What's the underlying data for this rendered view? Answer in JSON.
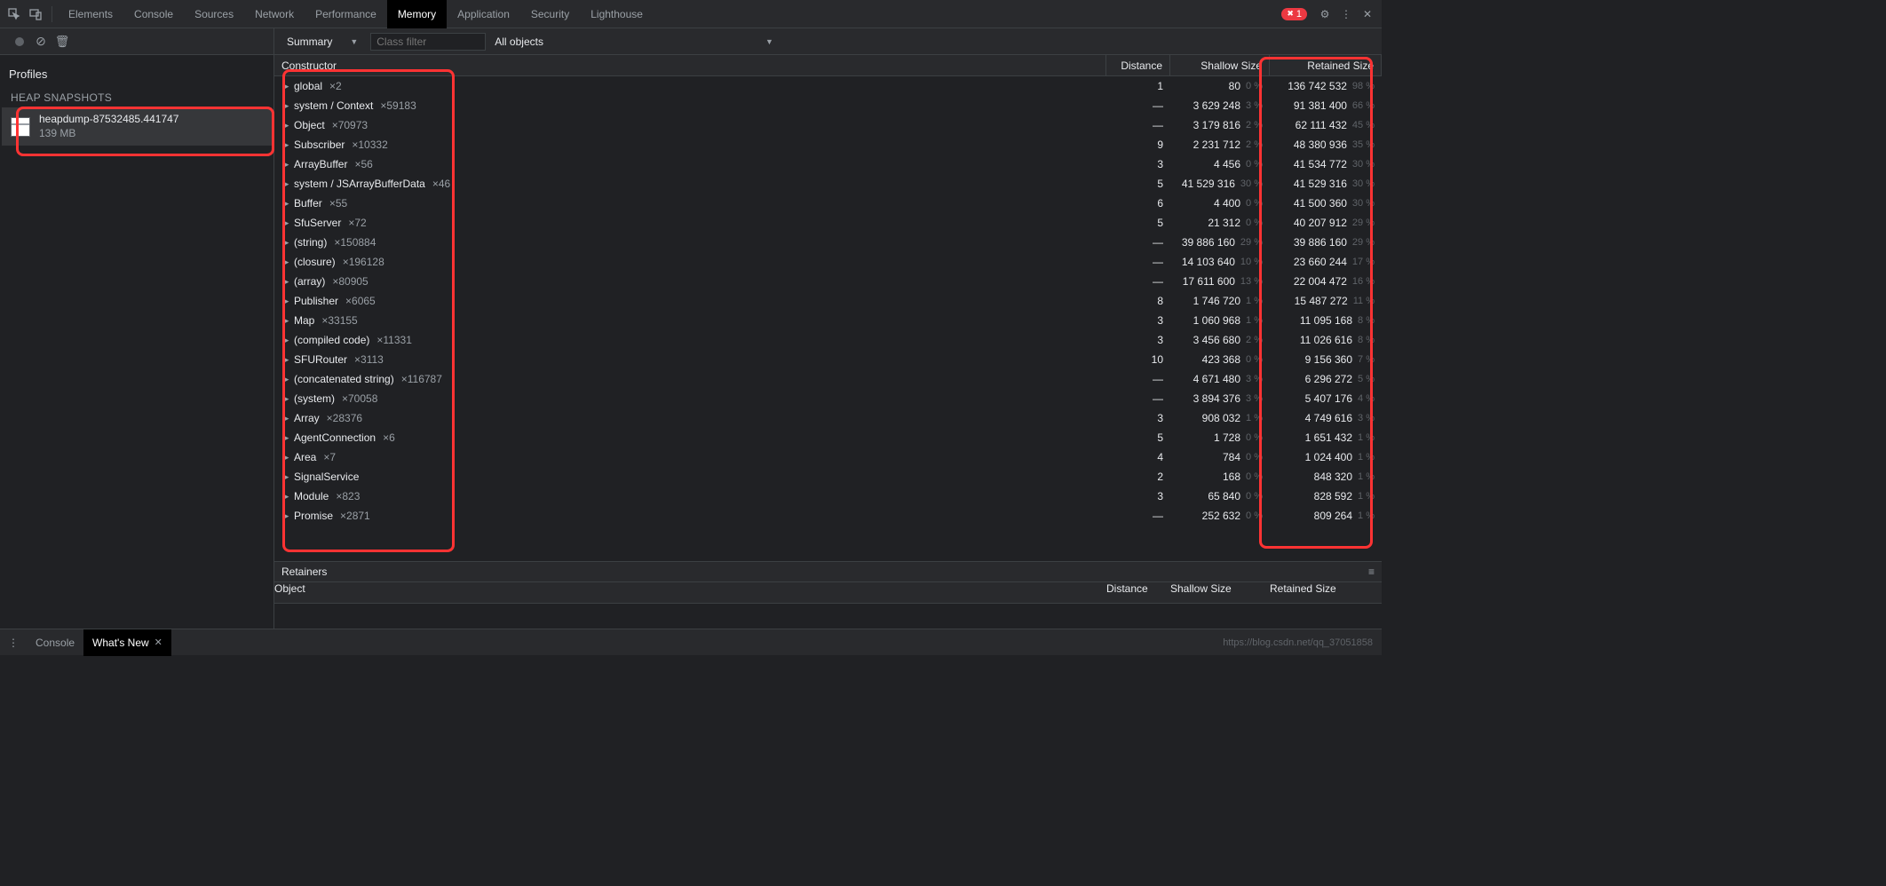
{
  "tabs": [
    "Elements",
    "Console",
    "Sources",
    "Network",
    "Performance",
    "Memory",
    "Application",
    "Security",
    "Lighthouse"
  ],
  "active_tab": "Memory",
  "error_count": "1",
  "toolbar": {
    "summary_label": "Summary",
    "filter_placeholder": "Class filter",
    "scope_label": "All objects"
  },
  "sidebar": {
    "profiles_label": "Profiles",
    "section_label": "HEAP SNAPSHOTS",
    "snapshot": {
      "name": "heapdump-87532485.441747",
      "size": "139 MB"
    }
  },
  "columns": {
    "constructor": "Constructor",
    "distance": "Distance",
    "shallow": "Shallow Size",
    "retained": "Retained Size"
  },
  "rows": [
    {
      "name": "global",
      "count": "×2",
      "distance": "1",
      "shallow": "80",
      "shallow_pct": "0 %",
      "retained": "136 742 532",
      "retained_pct": "98 %"
    },
    {
      "name": "system / Context",
      "count": "×59183",
      "distance": "—",
      "shallow": "3 629 248",
      "shallow_pct": "3 %",
      "retained": "91 381 400",
      "retained_pct": "66 %"
    },
    {
      "name": "Object",
      "count": "×70973",
      "distance": "—",
      "shallow": "3 179 816",
      "shallow_pct": "2 %",
      "retained": "62 111 432",
      "retained_pct": "45 %"
    },
    {
      "name": "Subscriber",
      "count": "×10332",
      "distance": "9",
      "shallow": "2 231 712",
      "shallow_pct": "2 %",
      "retained": "48 380 936",
      "retained_pct": "35 %"
    },
    {
      "name": "ArrayBuffer",
      "count": "×56",
      "distance": "3",
      "shallow": "4 456",
      "shallow_pct": "0 %",
      "retained": "41 534 772",
      "retained_pct": "30 %"
    },
    {
      "name": "system / JSArrayBufferData",
      "count": "×46",
      "distance": "5",
      "shallow": "41 529 316",
      "shallow_pct": "30 %",
      "retained": "41 529 316",
      "retained_pct": "30 %"
    },
    {
      "name": "Buffer",
      "count": "×55",
      "distance": "6",
      "shallow": "4 400",
      "shallow_pct": "0 %",
      "retained": "41 500 360",
      "retained_pct": "30 %"
    },
    {
      "name": "SfuServer",
      "count": "×72",
      "distance": "5",
      "shallow": "21 312",
      "shallow_pct": "0 %",
      "retained": "40 207 912",
      "retained_pct": "29 %"
    },
    {
      "name": "(string)",
      "count": "×150884",
      "distance": "—",
      "shallow": "39 886 160",
      "shallow_pct": "29 %",
      "retained": "39 886 160",
      "retained_pct": "29 %"
    },
    {
      "name": "(closure)",
      "count": "×196128",
      "distance": "—",
      "shallow": "14 103 640",
      "shallow_pct": "10 %",
      "retained": "23 660 244",
      "retained_pct": "17 %"
    },
    {
      "name": "(array)",
      "count": "×80905",
      "distance": "—",
      "shallow": "17 611 600",
      "shallow_pct": "13 %",
      "retained": "22 004 472",
      "retained_pct": "16 %"
    },
    {
      "name": "Publisher",
      "count": "×6065",
      "distance": "8",
      "shallow": "1 746 720",
      "shallow_pct": "1 %",
      "retained": "15 487 272",
      "retained_pct": "11 %"
    },
    {
      "name": "Map",
      "count": "×33155",
      "distance": "3",
      "shallow": "1 060 968",
      "shallow_pct": "1 %",
      "retained": "11 095 168",
      "retained_pct": "8 %"
    },
    {
      "name": "(compiled code)",
      "count": "×11331",
      "distance": "3",
      "shallow": "3 456 680",
      "shallow_pct": "2 %",
      "retained": "11 026 616",
      "retained_pct": "8 %"
    },
    {
      "name": "SFURouter",
      "count": "×3113",
      "distance": "10",
      "shallow": "423 368",
      "shallow_pct": "0 %",
      "retained": "9 156 360",
      "retained_pct": "7 %"
    },
    {
      "name": "(concatenated string)",
      "count": "×116787",
      "distance": "—",
      "shallow": "4 671 480",
      "shallow_pct": "3 %",
      "retained": "6 296 272",
      "retained_pct": "5 %"
    },
    {
      "name": "(system)",
      "count": "×70058",
      "distance": "—",
      "shallow": "3 894 376",
      "shallow_pct": "3 %",
      "retained": "5 407 176",
      "retained_pct": "4 %"
    },
    {
      "name": "Array",
      "count": "×28376",
      "distance": "3",
      "shallow": "908 032",
      "shallow_pct": "1 %",
      "retained": "4 749 616",
      "retained_pct": "3 %"
    },
    {
      "name": "AgentConnection",
      "count": "×6",
      "distance": "5",
      "shallow": "1 728",
      "shallow_pct": "0 %",
      "retained": "1 651 432",
      "retained_pct": "1 %"
    },
    {
      "name": "Area",
      "count": "×7",
      "distance": "4",
      "shallow": "784",
      "shallow_pct": "0 %",
      "retained": "1 024 400",
      "retained_pct": "1 %"
    },
    {
      "name": "SignalService",
      "count": "",
      "distance": "2",
      "shallow": "168",
      "shallow_pct": "0 %",
      "retained": "848 320",
      "retained_pct": "1 %"
    },
    {
      "name": "Module",
      "count": "×823",
      "distance": "3",
      "shallow": "65 840",
      "shallow_pct": "0 %",
      "retained": "828 592",
      "retained_pct": "1 %"
    },
    {
      "name": "Promise",
      "count": "×2871",
      "distance": "—",
      "shallow": "252 632",
      "shallow_pct": "0 %",
      "retained": "809 264",
      "retained_pct": "1 %"
    }
  ],
  "retainers": {
    "title": "Retainers",
    "col_object": "Object",
    "col_distance": "Distance",
    "col_shallow": "Shallow Size",
    "col_retained": "Retained Size"
  },
  "drawer": {
    "console": "Console",
    "whatsnew": "What's New"
  },
  "watermark": "https://blog.csdn.net/qq_37051858"
}
